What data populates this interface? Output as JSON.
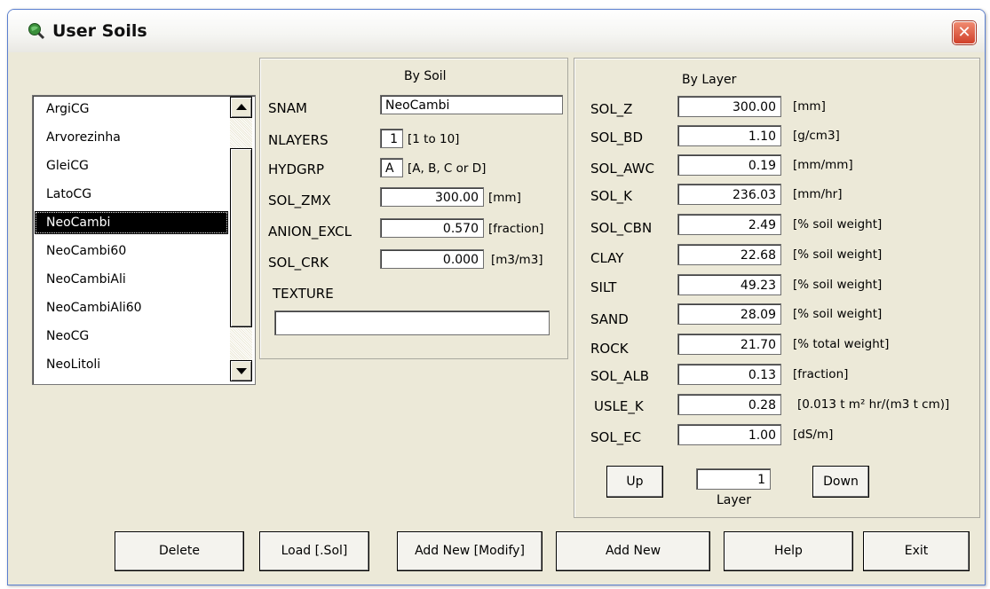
{
  "window": {
    "title": "User Soils",
    "close_glyph": "✕"
  },
  "soil_list": {
    "items": [
      "ArgiCG",
      "Arvorezinha",
      "GleiCG",
      "LatoCG",
      "NeoCambi",
      "NeoCambi60",
      "NeoCambiAli",
      "NeoCambiAli60",
      "NeoCG",
      "NeoLitoli"
    ],
    "selected": "NeoCambi"
  },
  "by_soil": {
    "header": "By Soil",
    "snam": {
      "label": "SNAM",
      "value": "NeoCambi"
    },
    "nlayers": {
      "label": "NLAYERS",
      "value": "1",
      "unit": "[1 to 10]"
    },
    "hydgrp": {
      "label": "HYDGRP",
      "value": "A",
      "unit": "[A, B, C or D]"
    },
    "sol_zmx": {
      "label": "SOL_ZMX",
      "value": "300.00",
      "unit": "[mm]"
    },
    "anion_excl": {
      "label": "ANION_EXCL",
      "value": "0.570",
      "unit": "[fraction]"
    },
    "sol_crk": {
      "label": "SOL_CRK",
      "value": "0.000",
      "unit": "[m3/m3]"
    },
    "texture": {
      "label": "TEXTURE",
      "value": ""
    }
  },
  "by_layer": {
    "header": "By Layer",
    "rows": [
      {
        "label": "SOL_Z",
        "value": "300.00",
        "unit": "[mm]"
      },
      {
        "label": "SOL_BD",
        "value": "1.10",
        "unit": "[g/cm3]"
      },
      {
        "label": "SOL_AWC",
        "value": "0.19",
        "unit": "[mm/mm]"
      },
      {
        "label": "SOL_K",
        "value": "236.03",
        "unit": "[mm/hr]"
      },
      {
        "label": "SOL_CBN",
        "value": "2.49",
        "unit": "[% soil weight]"
      },
      {
        "label": "CLAY",
        "value": "22.68",
        "unit": "[% soil weight]"
      },
      {
        "label": "SILT",
        "value": "49.23",
        "unit": "[% soil weight]"
      },
      {
        "label": "SAND",
        "value": "28.09",
        "unit": "[% soil weight]"
      },
      {
        "label": "ROCK",
        "value": "21.70",
        "unit": "[% total weight]"
      },
      {
        "label": "SOL_ALB",
        "value": "0.13",
        "unit": "[fraction]"
      },
      {
        "label": "USLE_K",
        "value": "0.28",
        "unit": "[0.013 t m² hr/(m3 t cm)]"
      },
      {
        "label": "SOL_EC",
        "value": "1.00",
        "unit": "[dS/m]"
      }
    ],
    "up_label": "Up",
    "down_label": "Down",
    "layer_value": "1",
    "layer_label": "Layer"
  },
  "buttons": {
    "delete": "Delete",
    "load": "Load [.Sol]",
    "add_new_modify": "Add New [Modify]",
    "add_new": "Add New",
    "help": "Help",
    "exit": "Exit"
  }
}
